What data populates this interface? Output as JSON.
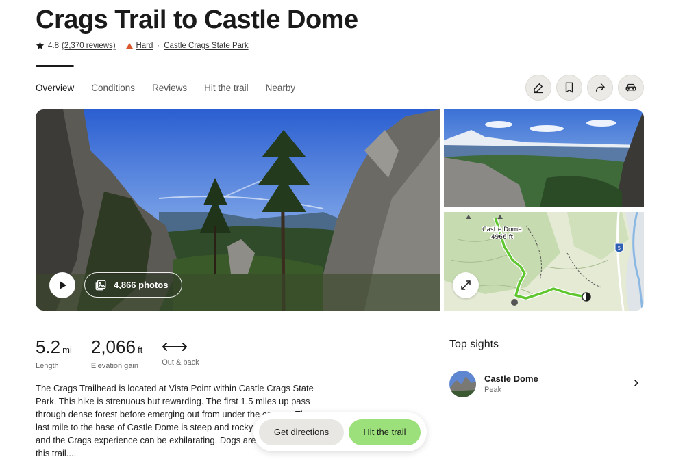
{
  "title": "Crags Trail to Castle Dome",
  "meta": {
    "rating": "4.8",
    "reviews": "(2,370 reviews)",
    "difficulty": "Hard",
    "park": "Castle Crags State Park"
  },
  "tabs": [
    {
      "label": "Overview"
    },
    {
      "label": "Conditions"
    },
    {
      "label": "Reviews"
    },
    {
      "label": "Hit the trail"
    },
    {
      "label": "Nearby"
    }
  ],
  "actions": [
    "pencil-icon",
    "bookmark-icon",
    "share-icon",
    "car-icon"
  ],
  "media": {
    "photos_label": "4,866 photos",
    "map": {
      "peak_label_1": "Castle Dome",
      "peak_label_2": "4966 ft",
      "highway_shield": "5"
    }
  },
  "stats": {
    "length": {
      "value": "5.2",
      "unit": "mi",
      "label": "Length"
    },
    "elevation": {
      "value": "2,066",
      "unit": "ft",
      "label": "Elevation gain"
    },
    "route": {
      "label": "Out & back"
    }
  },
  "description": "The Crags Trailhead is located at Vista Point within Castle Crags State Park. This hike is strenuous but rewarding. The first 1.5 miles up pass through dense forest before emerging out from under the canopy. The last mile to the base of Castle Dome is steep and rocky with incredible and the Crags experience can be exhilarating. Dogs are not allowed on this trail....",
  "cta": {
    "directions": "Get directions",
    "hit_trail": "Hit the trail"
  },
  "top_sights": {
    "title": "Top sights",
    "items": [
      {
        "name": "Castle Dome",
        "type": "Peak"
      }
    ]
  },
  "colors": {
    "accent_green": "#9be07a",
    "difficulty": "#d9552c",
    "route_line": "#5fc62f"
  }
}
